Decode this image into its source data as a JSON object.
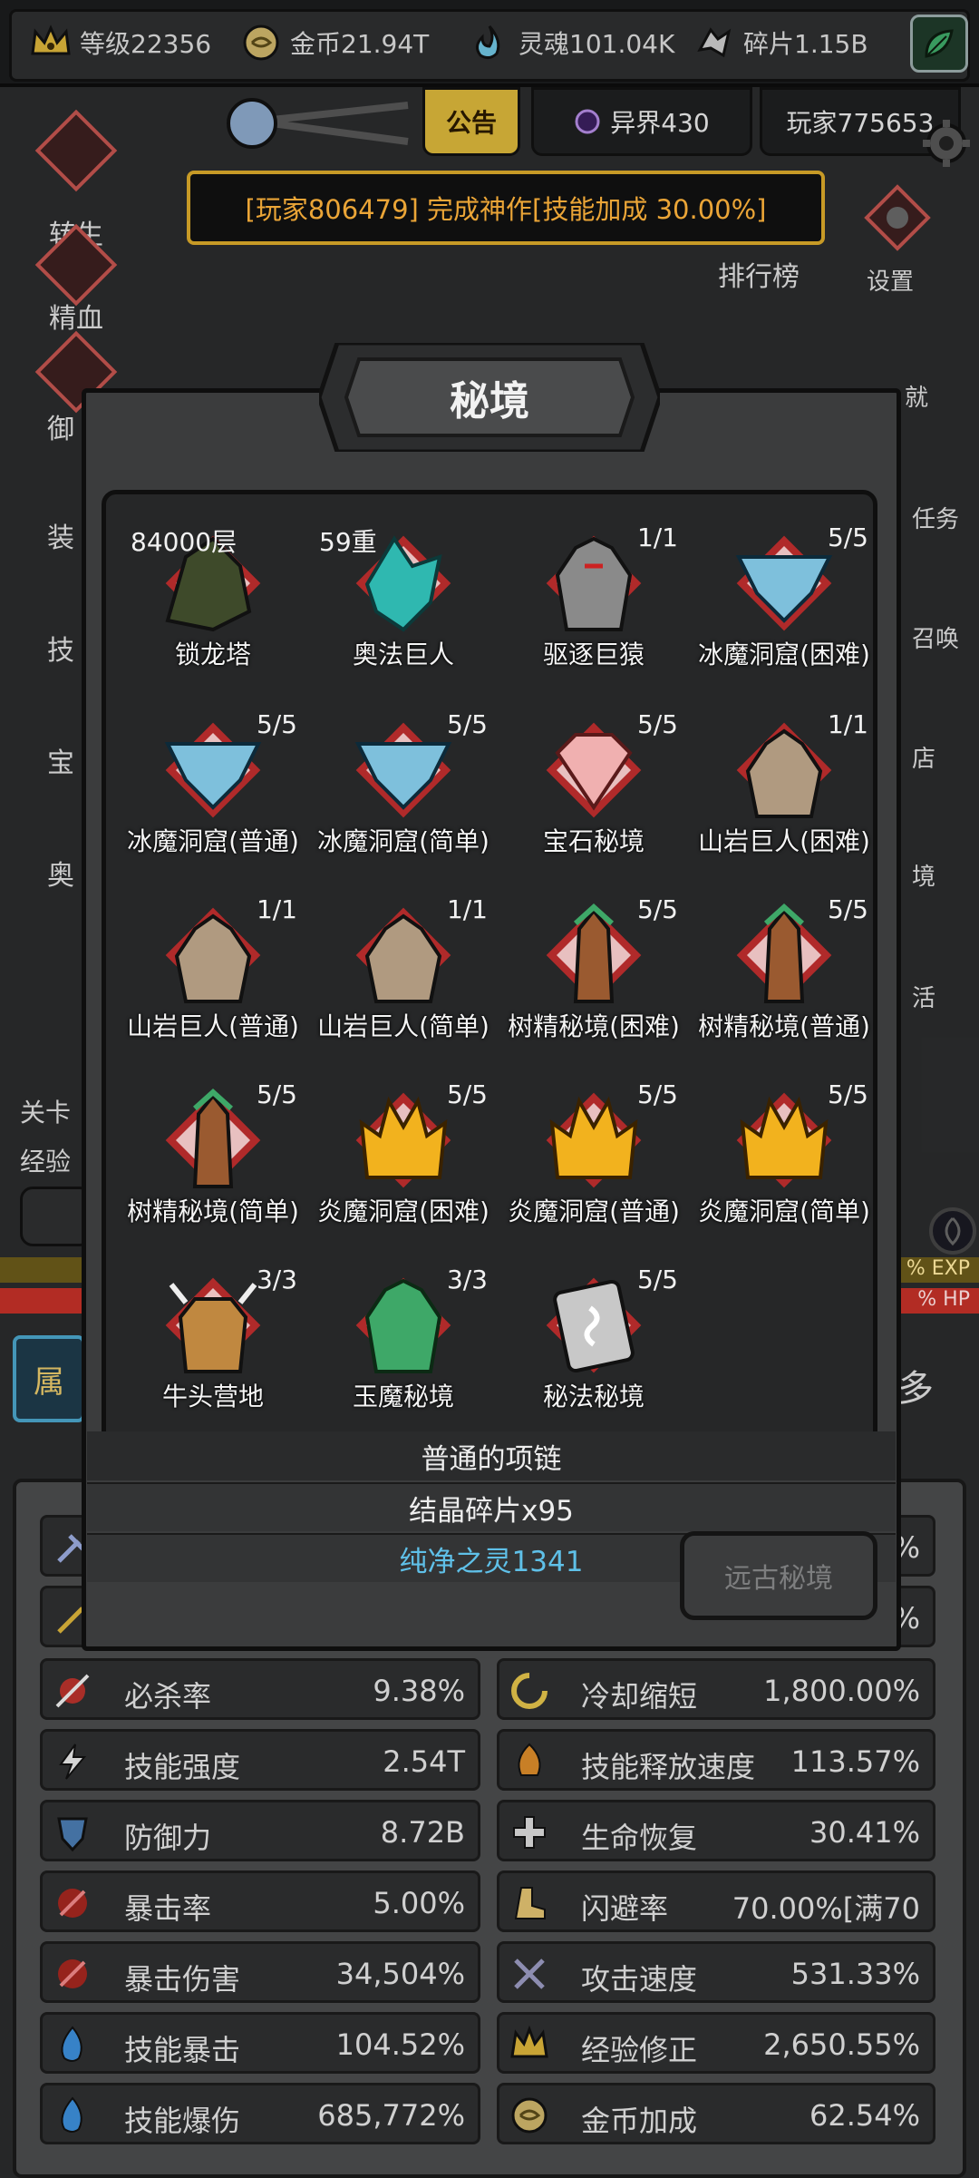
{
  "topbar": {
    "level": "等级22356",
    "gold": "金币21.94T",
    "soul": "灵魂101.04K",
    "fragment": "碎片1.15B"
  },
  "header": {
    "notice_tab": "公告",
    "otherworld": "异界430",
    "player": "玩家775653",
    "announcement": "[玩家806479] 完成神作[技能加成 30.00%]"
  },
  "left_menu": [
    "转生",
    "精血",
    "御",
    "装",
    "技",
    "宝",
    "奥"
  ],
  "right_menu": {
    "rank": "排行榜",
    "settings": "设置",
    "items": [
      "就",
      "任务",
      "召唤",
      "店",
      "境",
      "活"
    ]
  },
  "progress": {
    "stage_label": "关卡",
    "exp_label": "经验",
    "exp_suffix": "% EXP",
    "hp_suffix": "% HP",
    "attr_tab": "属",
    "more": "多"
  },
  "modal": {
    "title": "秘境",
    "dungeons": [
      {
        "name": "锁龙塔",
        "count": "84000层"
      },
      {
        "name": "奥法巨人",
        "count": "59重"
      },
      {
        "name": "驱逐巨猿",
        "count": "1/1"
      },
      {
        "name": "冰魔洞窟(困难)",
        "count": "5/5"
      },
      {
        "name": "冰魔洞窟(普通)",
        "count": "5/5"
      },
      {
        "name": "冰魔洞窟(简单)",
        "count": "5/5"
      },
      {
        "name": "宝石秘境",
        "count": "5/5"
      },
      {
        "name": "山岩巨人(困难)",
        "count": "1/1"
      },
      {
        "name": "山岩巨人(普通)",
        "count": "1/1"
      },
      {
        "name": "山岩巨人(简单)",
        "count": "1/1"
      },
      {
        "name": "树精秘境(困难)",
        "count": "5/5"
      },
      {
        "name": "树精秘境(普通)",
        "count": "5/5"
      },
      {
        "name": "树精秘境(简单)",
        "count": "5/5"
      },
      {
        "name": "炎魔洞窟(困难)",
        "count": "5/5"
      },
      {
        "name": "炎魔洞窟(普通)",
        "count": "5/5"
      },
      {
        "name": "炎魔洞窟(简单)",
        "count": "5/5"
      },
      {
        "name": "牛头营地",
        "count": "3/3"
      },
      {
        "name": "玉魔秘境",
        "count": "3/3"
      },
      {
        "name": "秘法秘境",
        "count": "5/5"
      }
    ],
    "rewards": [
      "普通的项链",
      "结晶碎片x95",
      "纯净之灵1341"
    ],
    "ancient_button": "远古秘境"
  },
  "stats": {
    "left": [
      {
        "name": "必杀率",
        "value": "9.38%"
      },
      {
        "name": "技能强度",
        "value": "2.54T"
      },
      {
        "name": "防御力",
        "value": "8.72B"
      },
      {
        "name": "暴击率",
        "value": "5.00%"
      },
      {
        "name": "暴击伤害",
        "value": "34,504%"
      },
      {
        "name": "技能暴击",
        "value": "104.52%"
      },
      {
        "name": "技能爆伤",
        "value": "685,772%"
      }
    ],
    "right": [
      {
        "name": "冷却缩短",
        "value": "1,800.00%"
      },
      {
        "name": "技能释放速度",
        "value": "113.57%"
      },
      {
        "name": "生命恢复",
        "value": "30.41%"
      },
      {
        "name": "闪避率",
        "value": "70.00%[满70"
      },
      {
        "name": "攻击速度",
        "value": "531.33%"
      },
      {
        "name": "经验修正",
        "value": "2,650.55%"
      },
      {
        "name": "金币加成",
        "value": "62.54%"
      }
    ],
    "hidden_right_values": [
      "%",
      "%"
    ]
  },
  "colors": {
    "accent_gold": "#d8a82a",
    "announce_text": "#ffb43c",
    "diamond_red": "#c2544f",
    "link_blue": "#5fc0e8"
  }
}
